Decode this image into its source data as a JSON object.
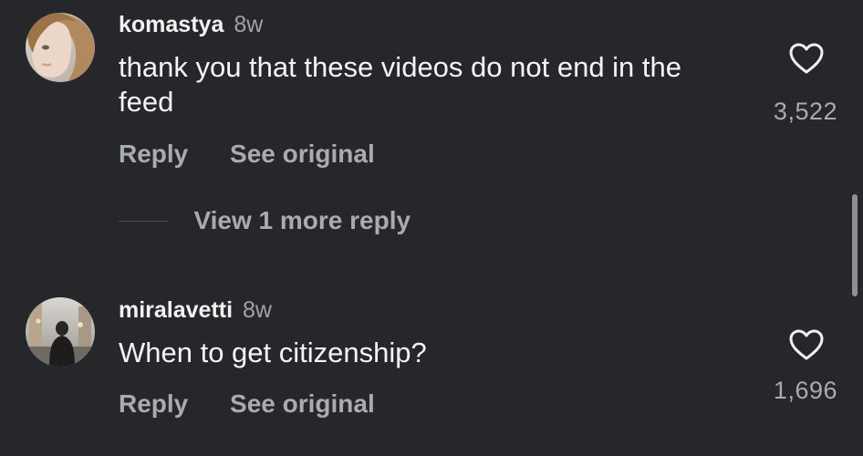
{
  "comments": [
    {
      "username": "komastya",
      "time": "8w",
      "text": "thank you that these videos do not end in the feed",
      "likes": "3,522",
      "reply_label": "Reply",
      "see_original_label": "See original",
      "more_replies_label": "View 1 more reply"
    },
    {
      "username": "miralavetti",
      "time": "8w",
      "text": "When to get citizenship?",
      "likes": "1,696",
      "reply_label": "Reply",
      "see_original_label": "See original"
    }
  ],
  "icons": {
    "like": "heart-icon",
    "avatar_1": "avatar-photo",
    "avatar_2": "avatar-photo"
  },
  "colors": {
    "background": "#26272b",
    "primary_text": "#f2f2f2",
    "secondary_text": "#a8abb0"
  }
}
